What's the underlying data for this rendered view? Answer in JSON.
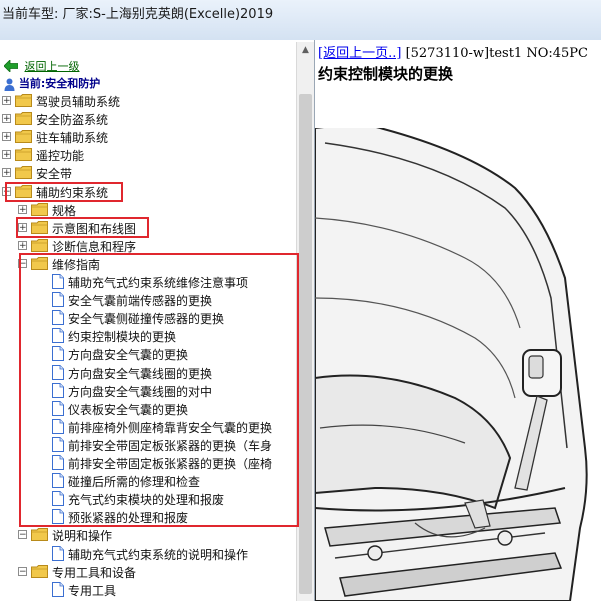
{
  "header": {
    "title": "当前车型:  厂家:S-上海别克英朗(Excelle)2019"
  },
  "tree": {
    "back_label": "返回上一级",
    "current_label": "当前:安全和防护",
    "items": [
      {
        "label": "驾驶员辅助系统",
        "level": 0,
        "type": "folder",
        "expander": "+"
      },
      {
        "label": "安全防盗系统",
        "level": 0,
        "type": "folder",
        "expander": "+"
      },
      {
        "label": "驻车辅助系统",
        "level": 0,
        "type": "folder",
        "expander": "+"
      },
      {
        "label": "遥控功能",
        "level": 0,
        "type": "folder",
        "expander": "+"
      },
      {
        "label": "安全带",
        "level": 0,
        "type": "folder",
        "expander": "+"
      },
      {
        "label": "辅助约束系统",
        "level": 0,
        "type": "folder",
        "expander": "-"
      },
      {
        "label": "规格",
        "level": 1,
        "type": "folder",
        "expander": "+"
      },
      {
        "label": "示意图和布线图",
        "level": 1,
        "type": "folder",
        "expander": "+"
      },
      {
        "label": "诊断信息和程序",
        "level": 1,
        "type": "folder",
        "expander": "+"
      },
      {
        "label": "维修指南",
        "level": 1,
        "type": "folder",
        "expander": "-"
      },
      {
        "label": "辅助充气式约束系统维修注意事项",
        "level": 2,
        "type": "doc"
      },
      {
        "label": "安全气囊前端传感器的更换",
        "level": 2,
        "type": "doc"
      },
      {
        "label": "安全气囊侧碰撞传感器的更换",
        "level": 2,
        "type": "doc"
      },
      {
        "label": "约束控制模块的更换",
        "level": 2,
        "type": "doc"
      },
      {
        "label": "方向盘安全气囊的更换",
        "level": 2,
        "type": "doc"
      },
      {
        "label": "方向盘安全气囊线圈的更换",
        "level": 2,
        "type": "doc"
      },
      {
        "label": "方向盘安全气囊线圈的对中",
        "level": 2,
        "type": "doc"
      },
      {
        "label": "仪表板安全气囊的更换",
        "level": 2,
        "type": "doc"
      },
      {
        "label": "前排座椅外侧座椅靠背安全气囊的更换",
        "level": 2,
        "type": "doc"
      },
      {
        "label": "前排安全带固定板张紧器的更换（车身",
        "level": 2,
        "type": "doc"
      },
      {
        "label": "前排安全带固定板张紧器的更换（座椅",
        "level": 2,
        "type": "doc"
      },
      {
        "label": "碰撞后所需的修理和检查",
        "level": 2,
        "type": "doc"
      },
      {
        "label": "充气式约束模块的处理和报废",
        "level": 2,
        "type": "doc"
      },
      {
        "label": "预张紧器的处理和报废",
        "level": 2,
        "type": "doc"
      },
      {
        "label": "说明和操作",
        "level": 1,
        "type": "folder",
        "expander": "-"
      },
      {
        "label": "辅助充气式约束系统的说明和操作",
        "level": 2,
        "type": "doc"
      },
      {
        "label": "专用工具和设备",
        "level": 1,
        "type": "folder",
        "expander": "-"
      },
      {
        "label": "专用工具",
        "level": 2,
        "type": "doc"
      }
    ]
  },
  "content": {
    "back_link": "[返回上一页..]",
    "doc_info": "[5273110-w]test1 NO:45PC",
    "title": "约束控制模块的更换"
  },
  "colors": {
    "highlight": "#e0272e",
    "folder": "#f1c84b",
    "link_green": "#006400",
    "link_blue": "#0000ee"
  }
}
